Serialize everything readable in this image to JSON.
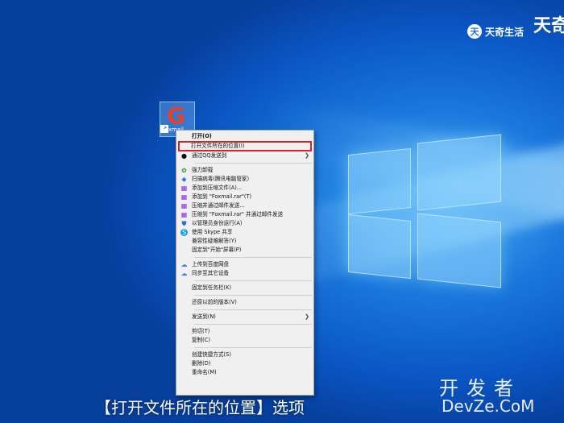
{
  "brand": {
    "small_text": "天奇生活",
    "big_text": "天奇",
    "mark": "天"
  },
  "desktop_icon": {
    "label": "Foxmail",
    "glyph": "G",
    "shortcut_glyph": "↗"
  },
  "menu": {
    "items": [
      {
        "label": "打开(O)",
        "bold": true
      },
      {
        "label": "打开文件所在的位置(I)",
        "highlighted": true
      },
      {
        "label": "通过QQ发送到",
        "icon": "qq-icon",
        "glyph": "●",
        "submenu": true
      },
      {
        "separator": true
      },
      {
        "label": "强力卸载",
        "icon": "uninstall-icon",
        "glyph": "✿"
      },
      {
        "label": "扫描病毒(腾讯电脑管家)",
        "icon": "virus-scan-icon",
        "glyph": "◆"
      },
      {
        "label": "添加到压缩文件(A)...",
        "icon": "rar-icon",
        "glyph": "▦"
      },
      {
        "label": "添加到 \"Foxmail.rar\"(T)",
        "icon": "rar-icon",
        "glyph": "▦"
      },
      {
        "label": "压缩并通过邮件发送...",
        "icon": "rar-icon",
        "glyph": "▦"
      },
      {
        "label": "压缩到 \"Foxmail.rar\" 并通过邮件发送",
        "icon": "rar-icon",
        "glyph": "▦"
      },
      {
        "label": "以管理员身份运行(A)",
        "icon": "admin-shield-icon",
        "glyph": "⛊"
      },
      {
        "label": "使用 Skype 共享",
        "icon": "skype-icon",
        "glyph": "S"
      },
      {
        "label": "兼容性疑难解答(Y)"
      },
      {
        "label": "固定到\"开始\"屏幕(P)"
      },
      {
        "separator": true
      },
      {
        "label": "上传到百度网盘",
        "icon": "cloud-upload-icon",
        "glyph": "☁"
      },
      {
        "label": "同步至其它设备",
        "icon": "cloud-sync-icon",
        "glyph": "☁"
      },
      {
        "separator": true
      },
      {
        "label": "固定到任务栏(K)"
      },
      {
        "separator": true
      },
      {
        "label": "还原以前的版本(V)"
      },
      {
        "separator": true
      },
      {
        "label": "发送到(N)",
        "submenu": true
      },
      {
        "separator": true
      },
      {
        "label": "剪切(T)"
      },
      {
        "label": "复制(C)"
      },
      {
        "separator": true
      },
      {
        "label": "创建快捷方式(S)"
      },
      {
        "label": "删除(D)"
      },
      {
        "label": "重命名(M)"
      }
    ],
    "arrow_glyph": "❯"
  },
  "caption": "【打开文件所在的位置】选项",
  "watermark": {
    "line1": "开发者",
    "line2": "DevZe.CoM"
  }
}
